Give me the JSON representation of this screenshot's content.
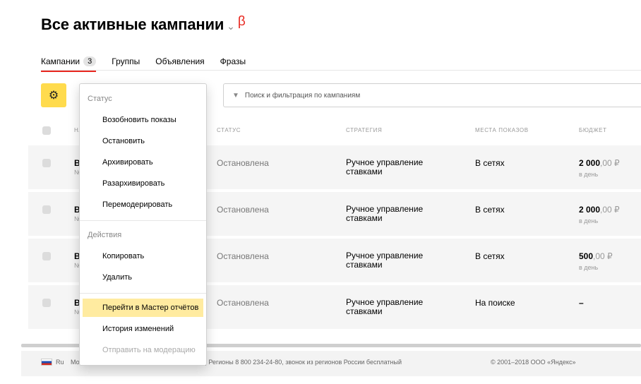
{
  "page": {
    "title": "Все активные кампании",
    "chevron": "⌄",
    "beta": "β"
  },
  "tabs": [
    {
      "label": "Кампании",
      "count": "3"
    },
    {
      "label": "Группы"
    },
    {
      "label": "Объявления"
    },
    {
      "label": "Фразы"
    }
  ],
  "toolbar": {
    "gear_icon": "gear-icon",
    "status_placeholder": "Статус",
    "search_placeholder": "Поиск и фильтрация по кампаниям"
  },
  "table": {
    "headers": {
      "name": "НА",
      "status": "СТАТУС",
      "strategy": "СТРАТЕГИЯ",
      "places": "МЕСТА ПОКАЗОВ",
      "budget": "БЮДЖЕТ"
    },
    "rows": [
      {
        "name": "Ве",
        "num": "№",
        "status": "Остановлена",
        "strategy_line1": "Ручное управление",
        "strategy_line2": "ставками",
        "places": "В сетях",
        "budget_main": "2 000",
        "budget_cents": ",00 ₽",
        "budget_per": "в день"
      },
      {
        "name": "Ве",
        "num": "№",
        "status": "Остановлена",
        "strategy_line1": "Ручное управление",
        "strategy_line2": "ставками",
        "places": "В сетях",
        "budget_main": "2 000",
        "budget_cents": ",00 ₽",
        "budget_per": "в день"
      },
      {
        "name": "Ве",
        "num": "№",
        "status": "Остановлена",
        "strategy_line1": "Ручное управление",
        "strategy_line2": "ставками",
        "places": "В сетях",
        "budget_main": "500",
        "budget_cents": ",00 ₽",
        "budget_per": "в день"
      },
      {
        "name": "Ве",
        "num": "№",
        "status": "Остановлена",
        "strategy_line1": "Ручное управление",
        "strategy_line2": "ставками",
        "places": "На поиске",
        "budget_main": "–",
        "budget_cents": "",
        "budget_per": ""
      }
    ]
  },
  "dropdown": {
    "status_header": "Статус",
    "status_items": [
      "Возобновить показы",
      "Остановить",
      "Архивировать",
      "Разархивировать",
      "Перемодерировать"
    ],
    "actions_header": "Действия",
    "action_items": [
      "Копировать",
      "Удалить"
    ],
    "extra_items": [
      "Перейти в Мастер отчётов",
      "История изменений",
      "Отправить на модерацию"
    ]
  },
  "footer": {
    "lang": "Ru",
    "mo": "Мо",
    "regions": "0 | Регионы 8 800 234-24-80, звонок из регионов России бесплатный",
    "copyright": "© 2001–2018 ООО «Яндекс»"
  },
  "colors": {
    "accent": "#ffdb4d",
    "beta": "#e8271f",
    "highlight": "#ffeba0"
  }
}
